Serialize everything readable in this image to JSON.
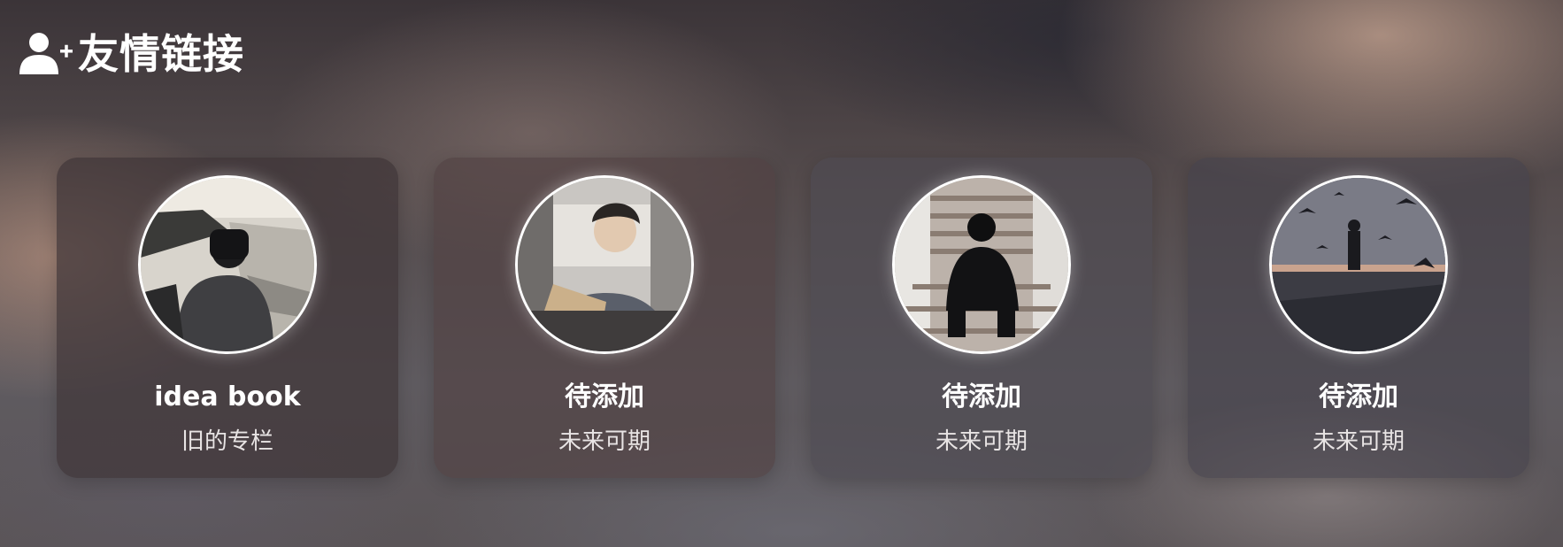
{
  "header": {
    "icon": "user-plus-icon",
    "title": "友情链接"
  },
  "links": [
    {
      "name": "idea book",
      "description": "旧的专栏",
      "avatar_icon": "avatar-image"
    },
    {
      "name": "待添加",
      "description": "未来可期",
      "avatar_icon": "avatar-image"
    },
    {
      "name": "待添加",
      "description": "未来可期",
      "avatar_icon": "avatar-image"
    },
    {
      "name": "待添加",
      "description": "未来可期",
      "avatar_icon": "avatar-image"
    }
  ]
}
